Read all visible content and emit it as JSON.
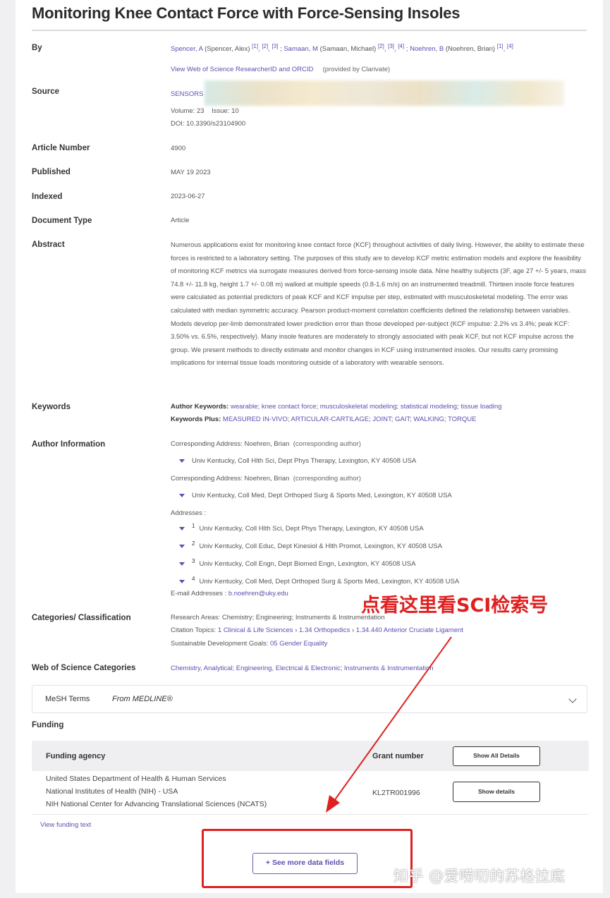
{
  "title": "Monitoring Knee Contact Force with Force-Sensing Insoles",
  "labels": {
    "by": "By",
    "source": "Source",
    "article_number": "Article Number",
    "published": "Published",
    "indexed": "Indexed",
    "document_type": "Document Type",
    "abstract": "Abstract",
    "keywords": "Keywords",
    "author_information": "Author Information",
    "categories": "Categories/ Classification",
    "wos_categories": "Web of Science Categories",
    "funding": "Funding"
  },
  "authors": [
    {
      "short": "Spencer, A",
      "full": "(Spencer, Alex)",
      "refs": [
        "[1]",
        "[2]",
        "[3]"
      ]
    },
    {
      "short": "Samaan, M",
      "full": "(Samaan, Michael)",
      "refs": [
        "[2]",
        "[3]",
        "[4]"
      ]
    },
    {
      "short": "Noehren, B",
      "full": "(Noehren, Brian)",
      "refs": [
        "[1]",
        "[4]"
      ]
    }
  ],
  "researcher_link": "View Web of Science ResearcherID and ORCID",
  "researcher_note": "(provided by Clarivate)",
  "source": {
    "journal": "SENSORS",
    "volume_label": "Volume:",
    "volume": "23",
    "issue_label": "Issue:",
    "issue": "10",
    "doi_label": "DOI:",
    "doi": "10.3390/s23104900"
  },
  "article_number": "4900",
  "published": "MAY 19 2023",
  "indexed": "2023-06-27",
  "document_type": "Article",
  "abstract": "Numerous applications exist for monitoring knee contact force (KCF) throughout activities of daily living. However, the ability to estimate these forces is restricted to a laboratory setting. The purposes of this study are to develop KCF metric estimation models and explore the feasibility of monitoring KCF metrics via surrogate measures derived from force-sensing insole data. Nine healthy subjects (3F, age 27 +/- 5 years, mass 74.8 +/- 11.8 kg, height 1.7 +/- 0.08 m) walked at multiple speeds (0.8-1.6 m/s) on an instrumented treadmill. Thirteen insole force features were calculated as potential predictors of peak KCF and KCF impulse per step, estimated with musculoskeletal modeling. The error was calculated with median symmetric accuracy. Pearson product-moment correlation coefficients defined the relationship between variables. Models develop per-limb demonstrated lower prediction error than those developed per-subject (KCF impulse: 2.2% vs 3.4%; peak KCF: 3.50% vs. 6.5%, respectively). Many insole features are moderately to strongly associated with peak KCF, but not KCF impulse across the group. We present methods to directly estimate and monitor changes in KCF using instrumented insoles. Our results carry promising implications for internal tissue loads monitoring outside of a laboratory with wearable sensors.",
  "keywords": {
    "author_label": "Author Keywords:",
    "author": [
      "wearable",
      "knee contact force",
      "musculoskeletal modeling",
      "statistical modeling",
      "tissue loading"
    ],
    "plus_label": "Keywords Plus:",
    "plus": [
      "MEASURED IN-VIVO",
      "ARTICULAR-CARTILAGE",
      "JOINT",
      "GAIT",
      "WALKING",
      "TORQUE"
    ]
  },
  "author_info": {
    "corr1_label": "Corresponding Address: Noehren, Brian",
    "corr1_note": "(corresponding author)",
    "corr1_addr": "Univ Kentucky, Coll Hlth Sci, Dept Phys Therapy, Lexington, KY 40508 USA",
    "corr2_label": "Corresponding Address: Noehren, Brian",
    "corr2_note": "(corresponding author)",
    "corr2_addr": "Univ Kentucky, Coll Med, Dept Orthoped Surg & Sports Med, Lexington, KY 40508 USA",
    "addresses_label": "Addresses :",
    "addresses": [
      {
        "num": "1",
        "text": "Univ Kentucky, Coll Hlth Sci, Dept Phys Therapy, Lexington, KY 40508 USA"
      },
      {
        "num": "2",
        "text": "Univ Kentucky, Coll Educ, Dept Kinesiol & Hlth Promot, Lexington, KY 40508 USA"
      },
      {
        "num": "3",
        "text": "Univ Kentucky, Coll Engn, Dept Biomed Engn, Lexington, KY 40508 USA"
      },
      {
        "num": "4",
        "text": "Univ Kentucky, Coll Med, Dept Orthoped Surg & Sports Med, Lexington, KY 40508 USA"
      }
    ],
    "email_label": "E-mail Addresses :",
    "email": "b.noehren@uky.edu"
  },
  "annotation": "点看这里看SCI检索号",
  "categories": {
    "research_areas": "Research Areas: Chemistry; Engineering; Instruments & Instrumentation",
    "citation_label": "Citation Topics:",
    "citation_1": "1 Clinical & Life Sciences",
    "citation_2": "1.34 Orthopedics",
    "citation_3": "1.34.440 Anterior Cruciate Ligament",
    "sdg_label": "Sustainable Development Goals:",
    "sdg": "05 Gender Equality"
  },
  "wos_categories": [
    "Chemistry, Analytical",
    "Engineering, Electrical & Electronic",
    "Instruments & Instrumentation"
  ],
  "mesh": {
    "label": "MeSH Terms",
    "source": "From MEDLINE®"
  },
  "funding_table": {
    "col_agency": "Funding agency",
    "col_grant": "Grant number",
    "show_all": "Show All Details",
    "agency_lines": [
      "United States Department of Health & Human Services",
      "National Institutes of Health (NIH) - USA",
      "NIH National Center for Advancing Translational Sciences (NCATS)"
    ],
    "grant": "KL2TR001996",
    "show_details": "Show details"
  },
  "view_funding_text": "View funding text",
  "see_more": "+ See more data fields",
  "watermark": "知乎 @爱唠叨的苏格拉底",
  "colors": {
    "link": "#5c4fb0",
    "annotation": "#e02020"
  }
}
